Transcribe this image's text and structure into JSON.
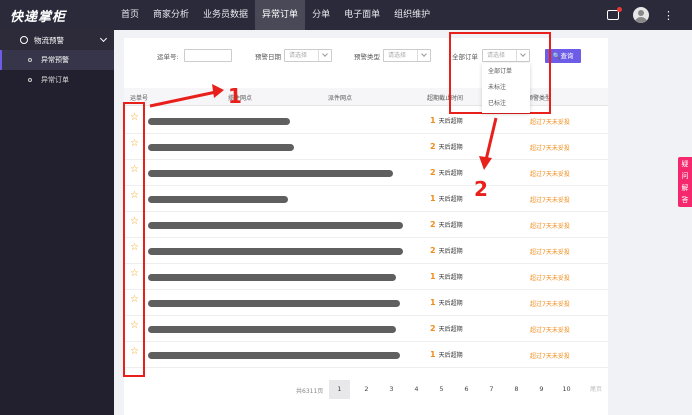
{
  "app": {
    "logo": "快递掌柜"
  },
  "nav": [
    "首页",
    "商家分析",
    "业务员数据",
    "异常订单",
    "分单",
    "电子面单",
    "组织维护"
  ],
  "sidebar": {
    "group": "物流预警",
    "items": [
      "异常预警",
      "异常订单"
    ]
  },
  "filters": {
    "waybill_label": "运单号:",
    "date_label": "预警日期",
    "date_placeholder": "请选择",
    "type_label": "预警类型",
    "type_placeholder": "请选择",
    "order_label": "全部订单",
    "order_placeholder": "请选择",
    "query_button": "查询"
  },
  "dropdown_options": [
    "全部订单",
    "未标注",
    "已标注"
  ],
  "table": {
    "headers": [
      "运单号",
      "揽件网点",
      "派件网点",
      "超期截止时间",
      "预警类型"
    ],
    "day_suffix": "天后超期",
    "rows": [
      {
        "days": "1",
        "warning": "超过7天未妥投"
      },
      {
        "days": "2",
        "warning": "超过7天未妥投"
      },
      {
        "days": "2",
        "warning": "超过7天未妥投"
      },
      {
        "days": "1",
        "warning": "超过7天未妥投"
      },
      {
        "days": "2",
        "warning": "超过7天未妥投"
      },
      {
        "days": "2",
        "warning": "超过7天未妥投"
      },
      {
        "days": "1",
        "warning": "超过7天未妥投"
      },
      {
        "days": "1",
        "warning": "超过7天未妥投"
      },
      {
        "days": "2",
        "warning": "超过7天未妥投"
      },
      {
        "days": "1",
        "warning": "超过7天未妥投"
      }
    ]
  },
  "pagination": {
    "total": "共6311页",
    "pages": [
      "1",
      "2",
      "3",
      "4",
      "5",
      "6",
      "7",
      "8",
      "9",
      "10"
    ],
    "current": "1",
    "next": "尾页"
  },
  "float_tab": [
    "疑",
    "问",
    "解",
    "答"
  ],
  "annotations": {
    "one": "1",
    "two": "2"
  },
  "colors": {
    "accent": "#6c5ce7",
    "warning": "#f08c1a",
    "annotation": "#e8201b",
    "float_tab": "#f5286e"
  }
}
